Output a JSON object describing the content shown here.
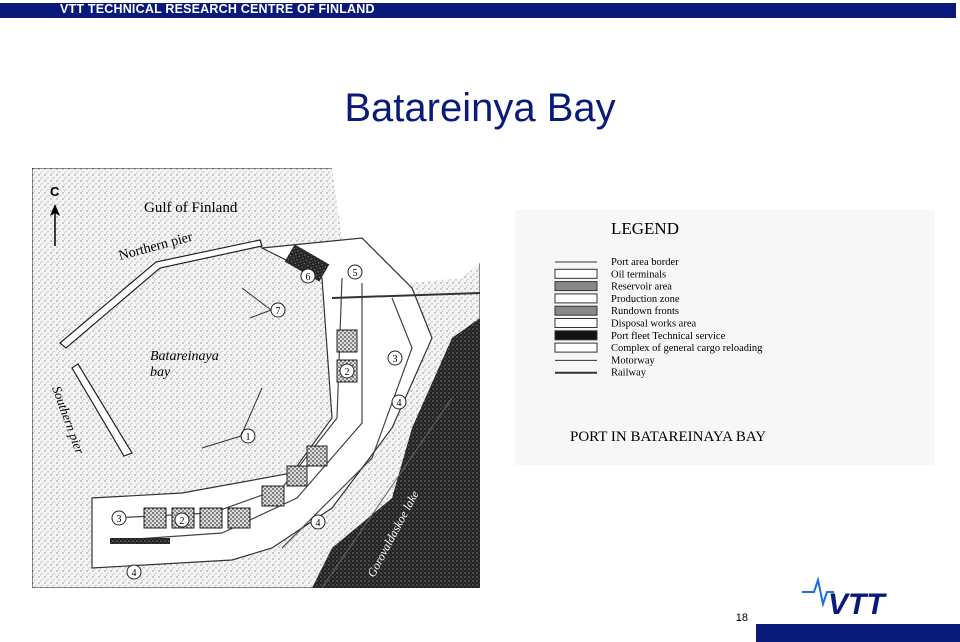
{
  "header": {
    "organization": "VTT TECHNICAL RESEARCH CENTRE OF FINLAND"
  },
  "slide": {
    "title": "Batareinya Bay",
    "page_number": "18"
  },
  "map": {
    "compass_label": "C",
    "labels": {
      "gulf": "Gulf of Finland",
      "northern_pier": "Northern pier",
      "bay_line1": "Batareinaya",
      "bay_line2": "bay",
      "southern_pier": "Southern pier",
      "lake": "Gorovaldaskoe lake"
    },
    "markers": [
      "1",
      "2",
      "2",
      "3",
      "3",
      "4",
      "4",
      "4",
      "5",
      "6",
      "7"
    ]
  },
  "legend": {
    "heading": "LEGEND",
    "items": [
      "Port area border",
      "Oil terminals",
      "Reservoir area",
      "Production zone",
      "Rundown fronts",
      "Disposal works area",
      "Port fleet Technical service",
      "Complex of general cargo reloading",
      "Motorway",
      "Railway"
    ],
    "caption": "PORT IN BATAREINAYA BAY"
  },
  "logo": {
    "text": "VTT"
  },
  "colors": {
    "brand_blue": "#0a1a7a"
  }
}
